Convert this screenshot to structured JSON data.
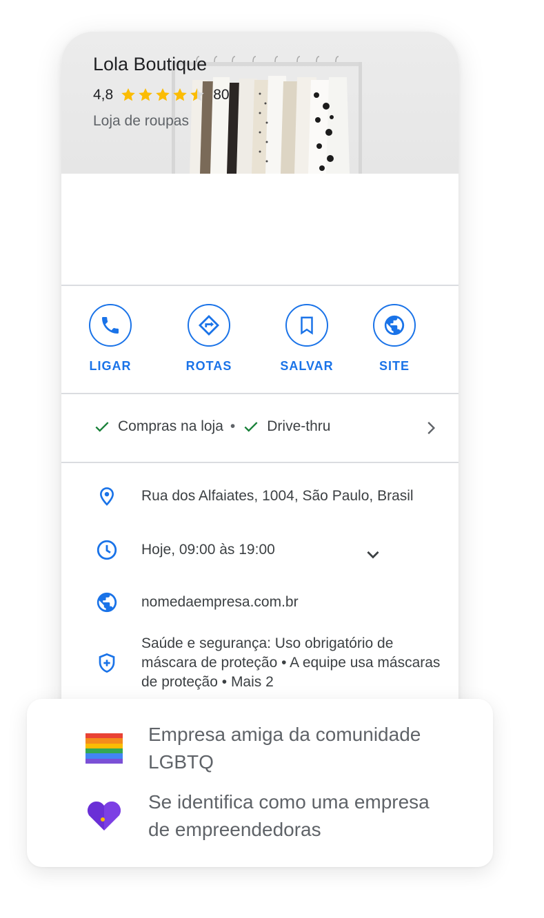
{
  "business": {
    "name": "Lola Boutique",
    "rating": "4,8",
    "review_count": "80",
    "stars_value": 4.5,
    "category": "Loja de roupas"
  },
  "actions": [
    {
      "label": "LIGAR",
      "icon": "phone-icon"
    },
    {
      "label": "ROTAS",
      "icon": "directions-icon"
    },
    {
      "label": "SALVAR",
      "icon": "bookmark-icon"
    },
    {
      "label": "SITE",
      "icon": "globe-icon"
    }
  ],
  "attributes": {
    "items": [
      "Compras na loja",
      "Drive-thru"
    ],
    "separator": "•"
  },
  "details": {
    "address": "Rua dos Alfaiates, 1004, São Paulo, Brasil",
    "hours": "Hoje, 09:00 às 19:00",
    "website": "nomedaempresa.com.br",
    "health_safety": "Saúde e segurança: Uso obrigatório de máscara de proteção • A equipe usa máscaras de proteção • Mais 2"
  },
  "highlights": [
    {
      "text": "Empresa amiga da comunidade LGBTQ",
      "icon": "rainbow-flag-icon"
    },
    {
      "text": "Se identifica como uma empresa de empreendedoras",
      "icon": "women-led-heart-icon"
    }
  ],
  "colors": {
    "accent": "#1a73e8",
    "star": "#fbbc04",
    "check": "#188038",
    "rainbow": [
      "#e94235",
      "#f48c1c",
      "#fbbc04",
      "#34a853",
      "#4285f4",
      "#7b50d6"
    ],
    "heart": "#6a2fd6"
  }
}
